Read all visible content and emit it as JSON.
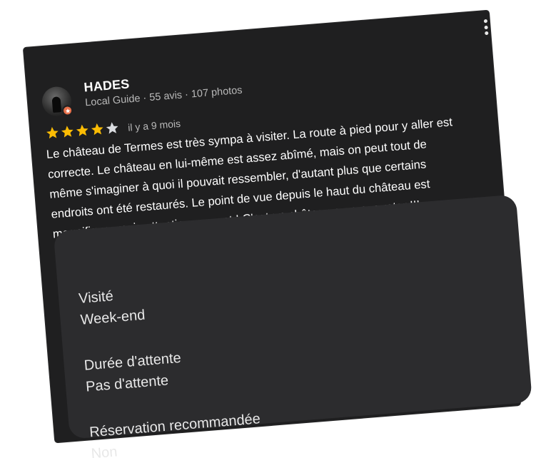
{
  "review": {
    "author": {
      "name": "HADES",
      "meta": "Local Guide · 55 avis · 107 photos",
      "avatar_icon": "castle-silhouette-avatar",
      "badge_icon": "local-guide-star-badge",
      "badge_color": "#e8704a"
    },
    "rating": {
      "stars_filled": 4,
      "stars_total": 5,
      "star_color": "#fbbc04",
      "empty_star_color": "#dadce0"
    },
    "time": "il y a 9 mois",
    "body_lines": [
      "Le château de Termes est très sympa à visiter. La route à pied pour y aller est",
      "correcte. Le château en lui-même est assez abîmé, mais on peut tout de",
      "même s'imaginer à quoi il pouvait ressembler, d'autant plus que certains",
      "endroits ont été restaurés. Le point de vue depuis le haut du château est",
      "magnifique, mais attention au vent ! C'est un château a ne pas rater !!!"
    ],
    "details": [
      {
        "label": "Visité",
        "value": "Week-end"
      },
      {
        "label": "Durée d'attente",
        "value": "Pas d'attente"
      },
      {
        "label": "Réservation recommandée",
        "value": "Non"
      }
    ],
    "menu_icon": "more-vert-icon"
  },
  "colors": {
    "card_background": "#1f1f20",
    "details_background": "#2c2c2e",
    "text_primary": "#ffffff",
    "text_secondary": "#b9b9b9"
  }
}
